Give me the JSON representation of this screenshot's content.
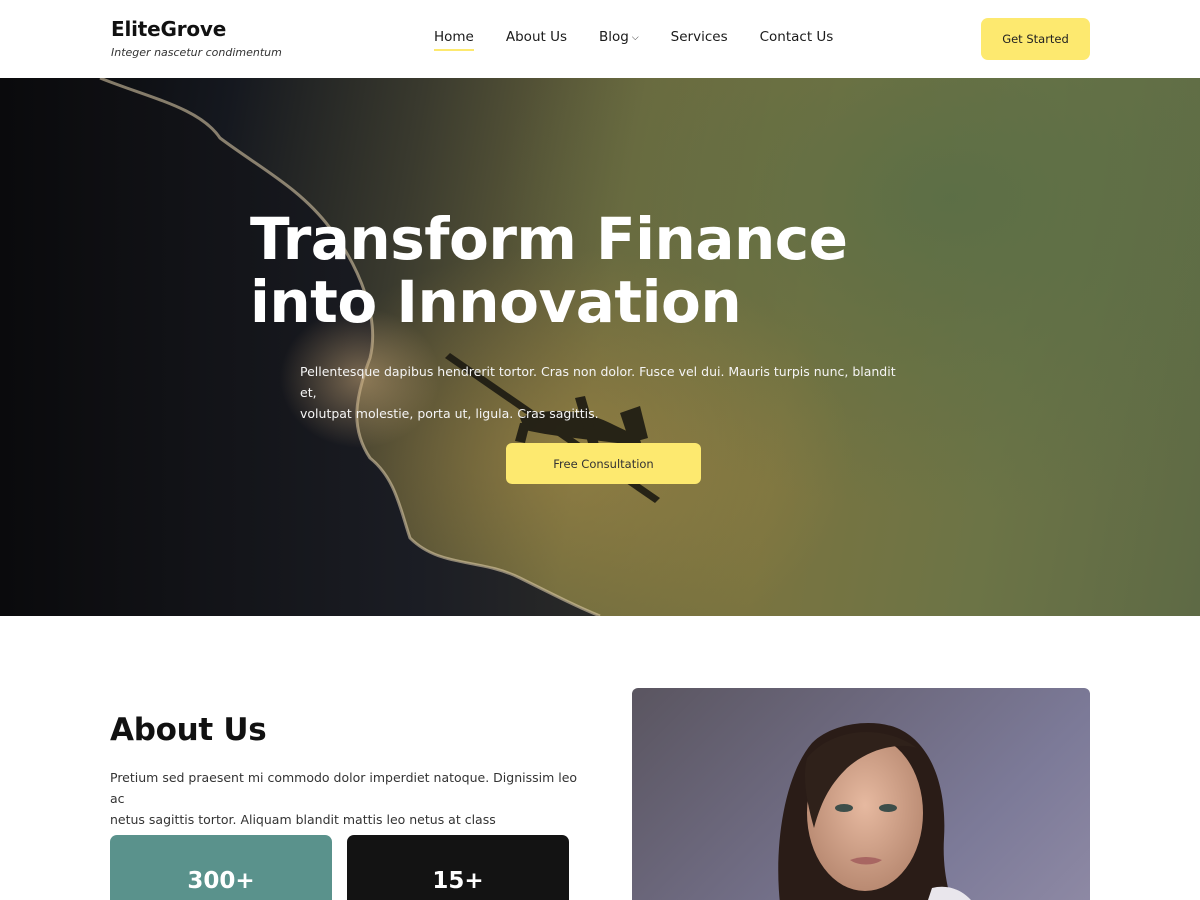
{
  "header": {
    "brand_title": "EliteGrove",
    "brand_tagline": "Integer nascetur condimentum",
    "nav": [
      {
        "label": "Home",
        "active": true
      },
      {
        "label": "About Us"
      },
      {
        "label": "Blog",
        "has_dropdown": true
      },
      {
        "label": "Services"
      },
      {
        "label": "Contact Us"
      }
    ],
    "cta_label": "Get Started"
  },
  "hero": {
    "title_line1": "Transform Finance",
    "title_line2": "into Innovation",
    "description_line1": "Pellentesque dapibus hendrerit tortor. Cras non dolor. Fusce vel dui. Mauris turpis nunc, blandit et,",
    "description_line2": "volutpat molestie, porta ut, ligula. Cras sagittis.",
    "button_label": "Free Consultation"
  },
  "about": {
    "title": "About Us",
    "text_line1": "Pretium sed praesent mi commodo dolor imperdiet natoque. Dignissim leo ac",
    "text_line2": "netus sagittis tortor. Aliquam blandit mattis leo netus at class",
    "stats": [
      {
        "value": "300+"
      },
      {
        "value": "15+"
      }
    ]
  },
  "colors": {
    "accent_yellow": "#fde96f",
    "stat_teal": "#5a928c",
    "stat_dark": "#131313"
  }
}
